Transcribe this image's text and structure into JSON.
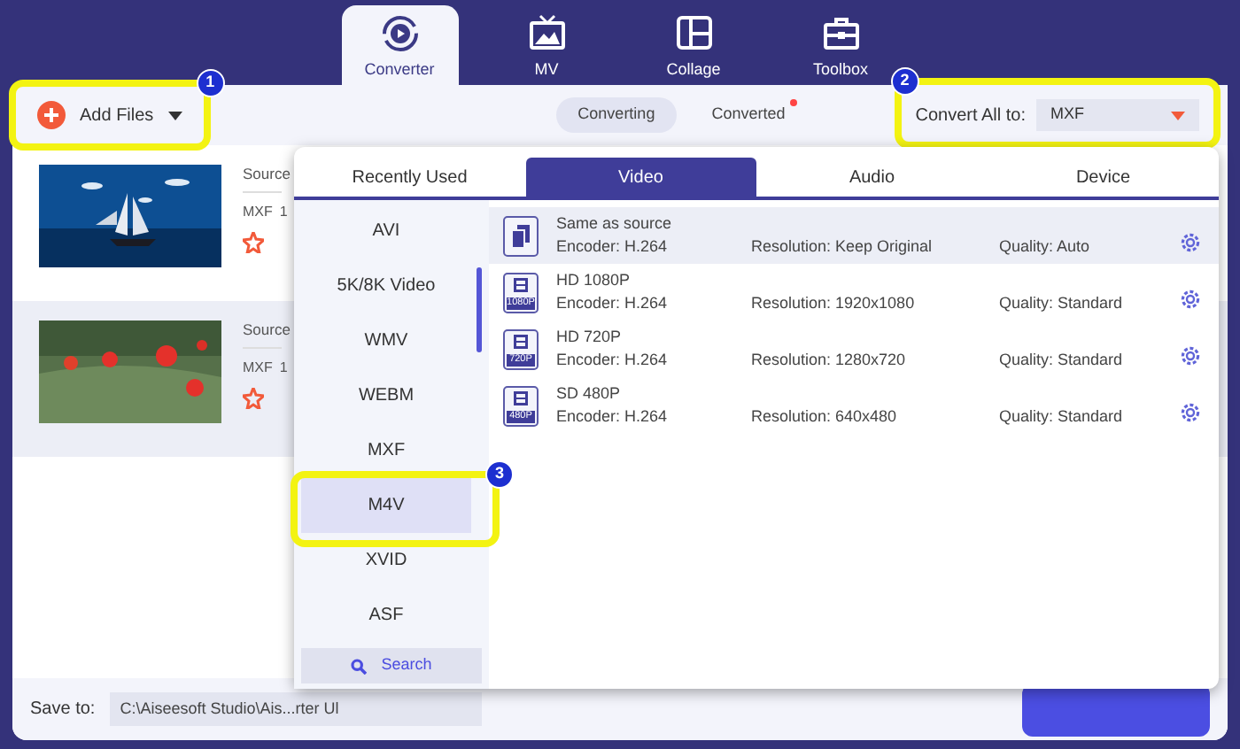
{
  "nav_tabs": [
    {
      "label": "Converter",
      "selected": true,
      "kind": "converter"
    },
    {
      "label": "MV",
      "selected": false,
      "kind": "mv"
    },
    {
      "label": "Collage",
      "selected": false,
      "kind": "collage"
    },
    {
      "label": "Toolbox",
      "selected": false,
      "kind": "toolbox"
    }
  ],
  "toolbar": {
    "add_files": {
      "label": "Add Files",
      "callout": "1"
    },
    "segments": [
      {
        "label": "Converting",
        "selected": true,
        "new_dot": false
      },
      {
        "label": "Converted",
        "selected": false,
        "new_dot": true
      }
    ],
    "convert_all": {
      "label": "Convert All to:",
      "value": "MXF",
      "callout": "2"
    }
  },
  "files": [
    {
      "source": "Source",
      "format": "MXF",
      "detail": "1",
      "selected": false,
      "kind": "picture"
    },
    {
      "source": "Source",
      "format": "MXF",
      "detail": "1",
      "selected": true,
      "kind": "picture"
    }
  ],
  "format_panel": {
    "tabs": [
      {
        "label": "Recently Used",
        "selected": false
      },
      {
        "label": "Video",
        "selected": true
      },
      {
        "label": "Audio",
        "selected": false
      },
      {
        "label": "Device",
        "selected": false
      }
    ],
    "categories": [
      {
        "label": "AVI",
        "selected": false
      },
      {
        "label": "5K/8K Video",
        "selected": false
      },
      {
        "label": "WMV",
        "selected": false
      },
      {
        "label": "WEBM",
        "selected": false
      },
      {
        "label": "MXF",
        "selected": false
      },
      {
        "label": "M4V",
        "selected": true,
        "callout": "3"
      },
      {
        "label": "XVID",
        "selected": false
      },
      {
        "label": "ASF",
        "selected": false
      }
    ],
    "search": "Search",
    "presets": [
      {
        "kind": "source",
        "name": "Same as source",
        "encoder": "Encoder: H.264",
        "resolution": "Resolution: Keep Original",
        "quality": "Quality: Auto",
        "selected": true
      },
      {
        "kind": "resolution",
        "icon_label": "1080P",
        "name": "HD 1080P",
        "encoder": "Encoder: H.264",
        "resolution": "Resolution: 1920x1080",
        "quality": "Quality: Standard",
        "selected": false
      },
      {
        "kind": "resolution",
        "icon_label": "720P",
        "name": "HD 720P",
        "encoder": "Encoder: H.264",
        "resolution": "Resolution: 1280x720",
        "quality": "Quality: Standard",
        "selected": false
      },
      {
        "kind": "resolution",
        "icon_label": "480P",
        "name": "SD 480P",
        "encoder": "Encoder: H.264",
        "resolution": "Resolution: 640x480",
        "quality": "Quality: Standard",
        "selected": false
      }
    ]
  },
  "save_bar": {
    "label": "Save to:",
    "path": "C:\\Aiseesoft Studio\\Ais...rter Ul"
  }
}
